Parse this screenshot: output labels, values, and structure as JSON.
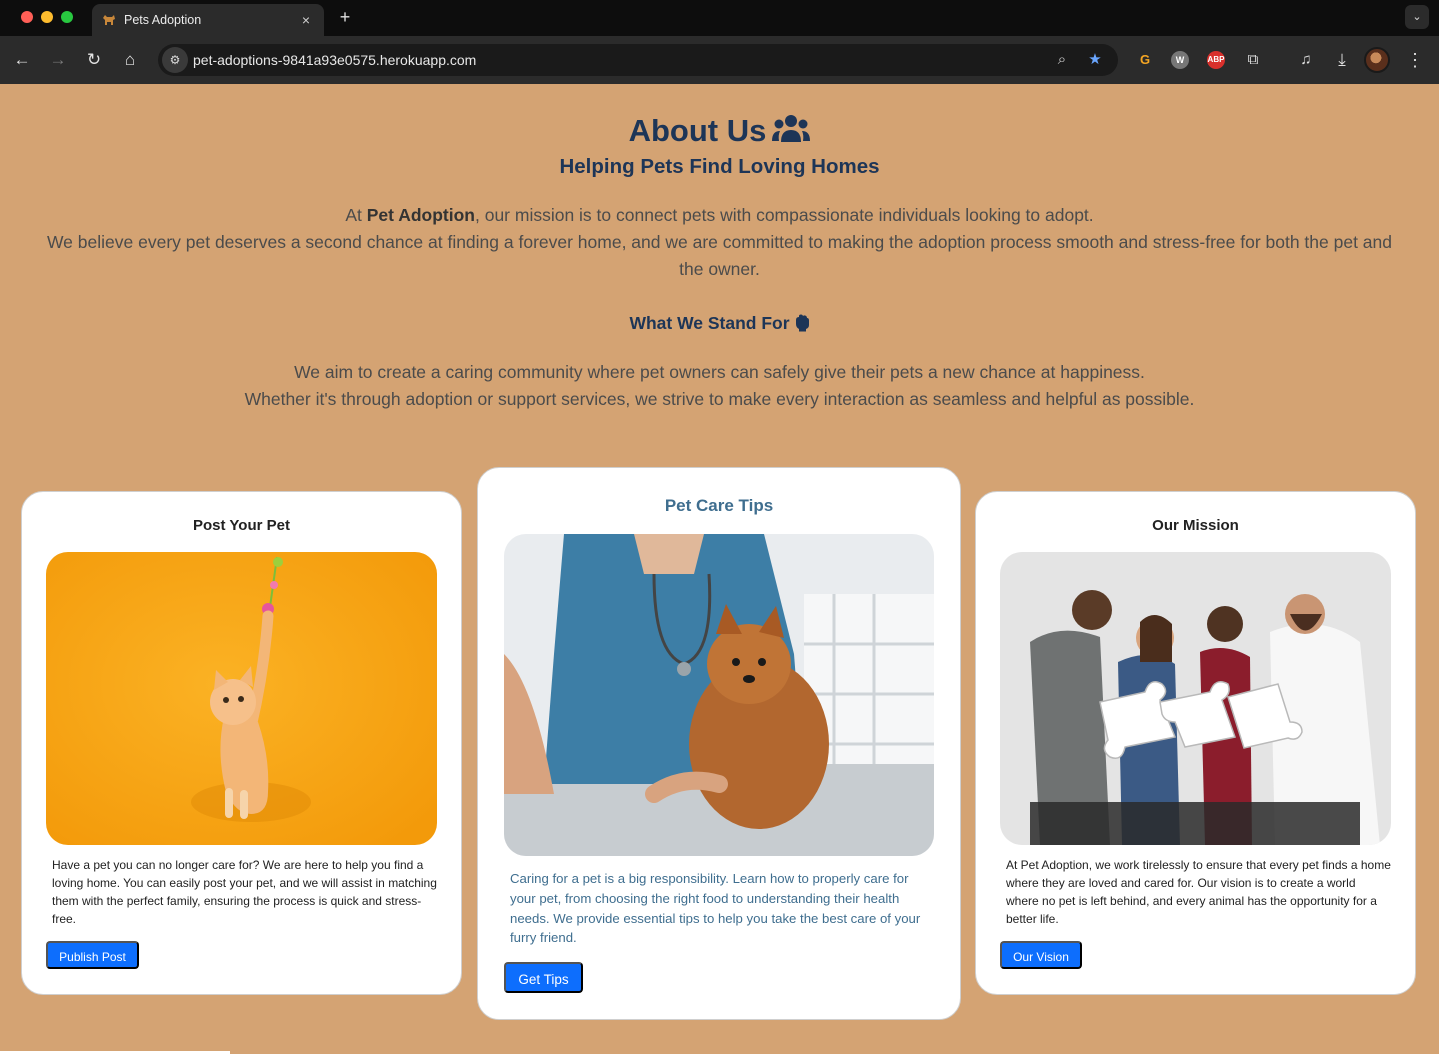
{
  "browser": {
    "tab": {
      "title": "Pets Adoption",
      "favicon": "dog-icon",
      "close": "×"
    },
    "new_tab": "+",
    "tab_menu": "⌄",
    "nav": {
      "back": "←",
      "forward": "→",
      "reload": "↻",
      "home": "⌂"
    },
    "site_info": "⚙",
    "url": "pet-adoptions-9841a93e0575.herokuapp.com",
    "extensions": {
      "zoom": "⌕",
      "bookmark": "★",
      "ext_g": "G",
      "ext_w": "W",
      "ext_abp": "ABP",
      "puzzle": "⧉",
      "media": "♫",
      "download": "⤓",
      "menu": "⋮"
    }
  },
  "page": {
    "title": "About Us",
    "subtitle": "Helping Pets Find Loving Homes",
    "intro": {
      "prefix": "At ",
      "brand": "Pet Adoption",
      "line1_rest": ", our mission is to connect pets with compassionate individuals looking to adopt.",
      "line2": "We believe every pet deserves a second chance at finding a forever home, and we are committed to making the adoption process smooth and stress-free for both the pet and the owner."
    },
    "stand_heading": "What We Stand For",
    "stand_line1": "We aim to create a caring community where pet owners can safely give their pets a new chance at happiness.",
    "stand_line2": "Whether it's through adoption or support services, we strive to make every interaction as seamless and helpful as possible.",
    "cards": [
      {
        "title": "Post Your Pet",
        "text": "Have a pet you can no longer care for? We are here to help you find a loving home. You can easily post your pet, and we will assist in matching them with the perfect family, ensuring the process is quick and stress-free.",
        "button": "Publish Post"
      },
      {
        "title": "Pet Care Tips",
        "text": "Caring for a pet is a big responsibility. Learn how to properly care for your pet, from choosing the right food to understanding their health needs. We provide essential tips to help you take the best care of your furry friend.",
        "button": "Get Tips"
      },
      {
        "title": "Our Mission",
        "text": "At Pet Adoption, we work tirelessly to ensure that every pet finds a home where they are loved and cared for. Our vision is to create a world where no pet is left behind, and every animal has the opportunity for a better life.",
        "button": "Our Vision"
      }
    ]
  },
  "colors": {
    "page_bg": "#d4a373",
    "heading": "#1d3557",
    "accent_text": "#3f6e8f",
    "button": "#0d6efd"
  }
}
